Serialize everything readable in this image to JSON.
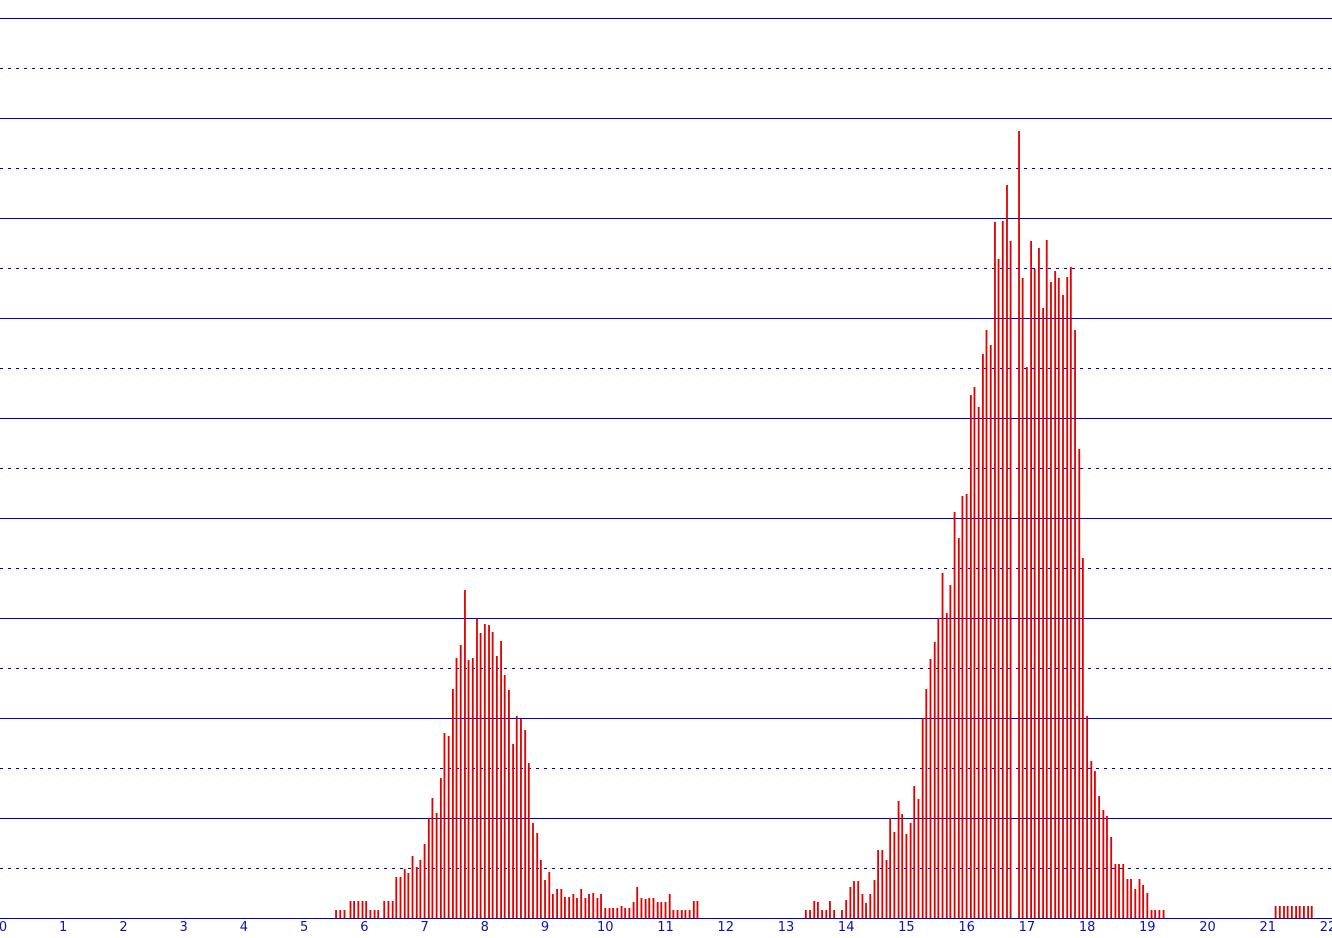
{
  "chart_data": {
    "type": "bar",
    "title": "",
    "xlabel": "",
    "ylabel": "",
    "xlim": [
      0,
      22
    ],
    "ylim": [
      0,
      9.2
    ],
    "grid": true,
    "colors": {
      "bar": "#e00000",
      "grid_major": "#0000c8",
      "grid_minor": "#0000c8",
      "axis_label": "#1010b0"
    },
    "x_tick_labels": [
      "0",
      "1",
      "2",
      "3",
      "4",
      "5",
      "6",
      "7",
      "8",
      "9",
      "10",
      "11",
      "12",
      "13",
      "14",
      "15",
      "16",
      "17",
      "18",
      "19",
      "20",
      "21",
      "22"
    ],
    "bar_width": 0.0667,
    "bars": [
      [
        5.53,
        0.08
      ],
      [
        5.6,
        0.08
      ],
      [
        5.67,
        0.08
      ],
      [
        5.77,
        0.17
      ],
      [
        5.83,
        0.17
      ],
      [
        5.9,
        0.17
      ],
      [
        5.97,
        0.17
      ],
      [
        6.03,
        0.17
      ],
      [
        6.1,
        0.08
      ],
      [
        6.17,
        0.08
      ],
      [
        6.23,
        0.08
      ],
      [
        6.33,
        0.17
      ],
      [
        6.4,
        0.17
      ],
      [
        6.47,
        0.17
      ],
      [
        6.53,
        0.41
      ],
      [
        6.6,
        0.41
      ],
      [
        6.67,
        0.49
      ],
      [
        6.73,
        0.45
      ],
      [
        6.8,
        0.62
      ],
      [
        6.87,
        0.51
      ],
      [
        6.93,
        0.58
      ],
      [
        7.0,
        0.74
      ],
      [
        7.07,
        1.0
      ],
      [
        7.13,
        1.2
      ],
      [
        7.2,
        1.05
      ],
      [
        7.27,
        1.4
      ],
      [
        7.33,
        1.85
      ],
      [
        7.4,
        1.82
      ],
      [
        7.47,
        2.29
      ],
      [
        7.53,
        2.6
      ],
      [
        7.6,
        2.73
      ],
      [
        7.67,
        3.28
      ],
      [
        7.73,
        2.58
      ],
      [
        7.8,
        2.6
      ],
      [
        7.87,
        2.99
      ],
      [
        7.93,
        2.85
      ],
      [
        8.0,
        2.94
      ],
      [
        8.07,
        2.93
      ],
      [
        8.13,
        2.86
      ],
      [
        8.2,
        2.62
      ],
      [
        8.27,
        2.77
      ],
      [
        8.33,
        2.43
      ],
      [
        8.4,
        2.28
      ],
      [
        8.47,
        1.74
      ],
      [
        8.53,
        2.02
      ],
      [
        8.6,
        1.99
      ],
      [
        8.67,
        1.88
      ],
      [
        8.73,
        1.55
      ],
      [
        8.8,
        0.95
      ],
      [
        8.87,
        0.85
      ],
      [
        8.93,
        0.58
      ],
      [
        9.0,
        0.38
      ],
      [
        9.07,
        0.46
      ],
      [
        9.13,
        0.24
      ],
      [
        9.2,
        0.29
      ],
      [
        9.27,
        0.29
      ],
      [
        9.33,
        0.21
      ],
      [
        9.4,
        0.21
      ],
      [
        9.47,
        0.24
      ],
      [
        9.53,
        0.2
      ],
      [
        9.6,
        0.29
      ],
      [
        9.67,
        0.2
      ],
      [
        9.73,
        0.24
      ],
      [
        9.8,
        0.25
      ],
      [
        9.87,
        0.2
      ],
      [
        9.93,
        0.24
      ],
      [
        10.0,
        0.1
      ],
      [
        10.07,
        0.1
      ],
      [
        10.13,
        0.1
      ],
      [
        10.2,
        0.1
      ],
      [
        10.27,
        0.12
      ],
      [
        10.33,
        0.1
      ],
      [
        10.4,
        0.1
      ],
      [
        10.47,
        0.16
      ],
      [
        10.53,
        0.31
      ],
      [
        10.6,
        0.2
      ],
      [
        10.67,
        0.19
      ],
      [
        10.73,
        0.2
      ],
      [
        10.8,
        0.2
      ],
      [
        10.87,
        0.16
      ],
      [
        10.93,
        0.16
      ],
      [
        11.0,
        0.16
      ],
      [
        11.07,
        0.24
      ],
      [
        11.13,
        0.08
      ],
      [
        11.2,
        0.08
      ],
      [
        11.27,
        0.08
      ],
      [
        11.33,
        0.08
      ],
      [
        11.4,
        0.08
      ],
      [
        11.47,
        0.17
      ],
      [
        11.53,
        0.17
      ],
      [
        13.33,
        0.08
      ],
      [
        13.4,
        0.08
      ],
      [
        13.47,
        0.17
      ],
      [
        13.53,
        0.16
      ],
      [
        13.6,
        0.08
      ],
      [
        13.67,
        0.08
      ],
      [
        13.73,
        0.17
      ],
      [
        13.8,
        0.08
      ],
      [
        13.93,
        0.08
      ],
      [
        14.0,
        0.18
      ],
      [
        14.07,
        0.31
      ],
      [
        14.13,
        0.37
      ],
      [
        14.2,
        0.37
      ],
      [
        14.27,
        0.24
      ],
      [
        14.33,
        0.15
      ],
      [
        14.4,
        0.24
      ],
      [
        14.47,
        0.38
      ],
      [
        14.53,
        0.68
      ],
      [
        14.6,
        0.68
      ],
      [
        14.67,
        0.58
      ],
      [
        14.73,
        1.0
      ],
      [
        14.8,
        0.86
      ],
      [
        14.87,
        1.17
      ],
      [
        14.93,
        1.04
      ],
      [
        15.0,
        0.84
      ],
      [
        15.07,
        0.95
      ],
      [
        15.13,
        1.32
      ],
      [
        15.2,
        1.19
      ],
      [
        15.27,
        2.0
      ],
      [
        15.33,
        2.29
      ],
      [
        15.4,
        2.59
      ],
      [
        15.47,
        2.76
      ],
      [
        15.53,
        3.0
      ],
      [
        15.6,
        3.45
      ],
      [
        15.67,
        3.05
      ],
      [
        15.73,
        3.33
      ],
      [
        15.8,
        4.06
      ],
      [
        15.87,
        3.8
      ],
      [
        15.93,
        4.22
      ],
      [
        16.0,
        4.24
      ],
      [
        16.07,
        5.23
      ],
      [
        16.13,
        5.31
      ],
      [
        16.2,
        5.11
      ],
      [
        16.27,
        5.64
      ],
      [
        16.33,
        5.88
      ],
      [
        16.4,
        5.73
      ],
      [
        16.47,
        6.96
      ],
      [
        16.53,
        6.59
      ],
      [
        16.6,
        6.97
      ],
      [
        16.67,
        7.33
      ],
      [
        16.73,
        6.77
      ],
      [
        16.87,
        7.87
      ],
      [
        16.93,
        6.4
      ],
      [
        17.0,
        5.51
      ],
      [
        17.07,
        6.77
      ],
      [
        17.13,
        6.49
      ],
      [
        17.2,
        6.7
      ],
      [
        17.27,
        6.1
      ],
      [
        17.33,
        6.78
      ],
      [
        17.4,
        6.36
      ],
      [
        17.47,
        6.47
      ],
      [
        17.53,
        6.4
      ],
      [
        17.6,
        6.23
      ],
      [
        17.67,
        6.41
      ],
      [
        17.73,
        6.51
      ],
      [
        17.8,
        5.88
      ],
      [
        17.87,
        4.69
      ],
      [
        17.93,
        3.6
      ],
      [
        18.0,
        2.02
      ],
      [
        18.07,
        1.57
      ],
      [
        18.13,
        1.47
      ],
      [
        18.2,
        1.22
      ],
      [
        18.27,
        1.08
      ],
      [
        18.33,
        1.02
      ],
      [
        18.4,
        0.81
      ],
      [
        18.47,
        0.54
      ],
      [
        18.53,
        0.54
      ],
      [
        18.6,
        0.54
      ],
      [
        18.67,
        0.39
      ],
      [
        18.73,
        0.39
      ],
      [
        18.8,
        0.29
      ],
      [
        18.87,
        0.39
      ],
      [
        18.93,
        0.33
      ],
      [
        19.0,
        0.25
      ],
      [
        19.07,
        0.08
      ],
      [
        19.13,
        0.08
      ],
      [
        19.2,
        0.08
      ],
      [
        19.27,
        0.08
      ],
      [
        21.13,
        0.12
      ],
      [
        21.2,
        0.12
      ],
      [
        21.27,
        0.12
      ],
      [
        21.33,
        0.12
      ],
      [
        21.4,
        0.12
      ],
      [
        21.47,
        0.12
      ],
      [
        21.53,
        0.12
      ],
      [
        21.6,
        0.12
      ],
      [
        21.67,
        0.12
      ],
      [
        21.73,
        0.12
      ]
    ]
  }
}
